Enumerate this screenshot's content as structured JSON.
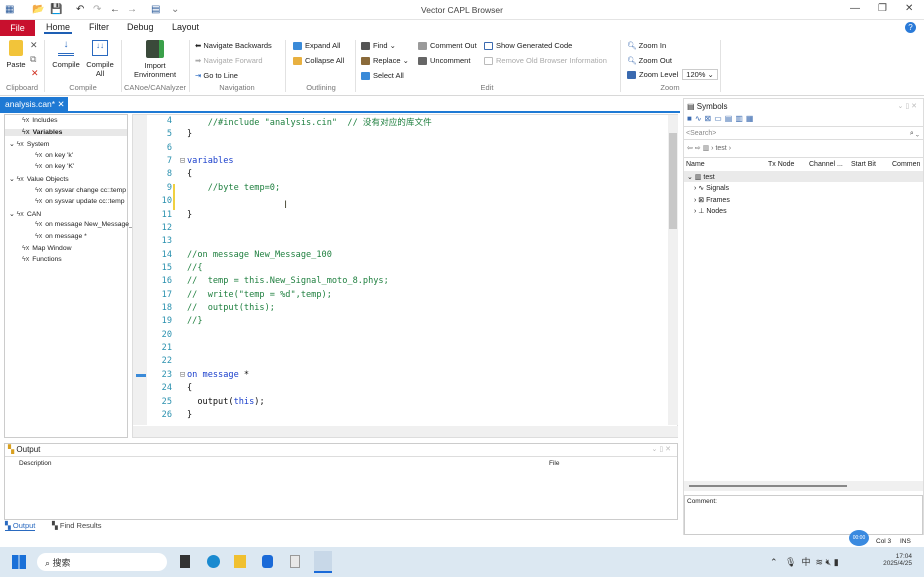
{
  "window": {
    "title": "Vector CAPL Browser"
  },
  "menu": {
    "file": "File",
    "tabs": [
      "Home",
      "Filter",
      "Debug",
      "Layout"
    ]
  },
  "ribbon": {
    "clipboard": {
      "paste": "Paste",
      "group": "Clipboard"
    },
    "compile": {
      "compile": "Compile",
      "compile_all_1": "Compile",
      "compile_all_2": "All",
      "group": "Compile"
    },
    "canoe": {
      "import_1": "Import",
      "import_2": "Environment",
      "group": "CANoe/CANalyzer"
    },
    "navigation": {
      "back": "Navigate Backwards",
      "forward": "Navigate Forward",
      "goto": "Go to Line",
      "group": "Navigation"
    },
    "outlining": {
      "expand": "Expand All",
      "collapse": "Collapse All",
      "group": "Outlining"
    },
    "edit": {
      "find": "Find",
      "replace": "Replace",
      "select_all": "Select All",
      "comment_out": "Comment Out",
      "uncomment": "Uncomment",
      "show_generated": "Show Generated Code",
      "remove_old": "Remove Old Browser Information",
      "group": "Edit"
    },
    "zoom": {
      "zoom_in": "Zoom In",
      "zoom_out": "Zoom Out",
      "zoom_level": "Zoom Level",
      "zoom_value": "120%",
      "group": "Zoom"
    }
  },
  "doc_tab": {
    "label": "analysis.can*"
  },
  "tree": [
    {
      "label": "Includes",
      "bold": false,
      "indent": 1
    },
    {
      "label": "Variables",
      "bold": true,
      "indent": 1
    },
    {
      "label": "System",
      "indent": 0,
      "expander": true
    },
    {
      "label": "on key 'k'",
      "indent": 2
    },
    {
      "label": "on key 'K'",
      "indent": 2
    },
    {
      "label": "Value Objects",
      "indent": 0,
      "expander": true
    },
    {
      "label": "on sysvar change cc::temp",
      "indent": 2
    },
    {
      "label": "on sysvar update cc::temp",
      "indent": 2
    },
    {
      "label": "CAN",
      "indent": 0,
      "expander": true
    },
    {
      "label": "on message New_Message_",
      "indent": 2
    },
    {
      "label": "on message *",
      "indent": 2
    },
    {
      "label": "Map Window",
      "indent": 1
    },
    {
      "label": "Functions",
      "indent": 1
    }
  ],
  "code": [
    {
      "n": "4",
      "s": [
        {
          "t": "    "
        },
        {
          "t": "//#include \"analysis.cin\"  // 没有对应的库文件",
          "c": "cm"
        }
      ]
    },
    {
      "n": "5",
      "s": [
        {
          "t": "}"
        }
      ]
    },
    {
      "n": "6",
      "s": []
    },
    {
      "n": "7",
      "s": [
        {
          "t": "variables",
          "c": "kw"
        }
      ]
    },
    {
      "n": "8",
      "s": [
        {
          "t": "{"
        }
      ]
    },
    {
      "n": "9",
      "s": [
        {
          "t": "    "
        },
        {
          "t": "//byte temp=0;",
          "c": "cm"
        }
      ]
    },
    {
      "n": "10",
      "s": []
    },
    {
      "n": "11",
      "s": [
        {
          "t": "}"
        }
      ]
    },
    {
      "n": "12",
      "s": []
    },
    {
      "n": "13",
      "s": []
    },
    {
      "n": "14",
      "s": [
        {
          "t": "//on message New_Message_100",
          "c": "cm"
        }
      ]
    },
    {
      "n": "15",
      "s": [
        {
          "t": "//{",
          "c": "cm"
        }
      ]
    },
    {
      "n": "16",
      "s": [
        {
          "t": "//  temp = this.New_Signal_moto_8.phys;",
          "c": "cm"
        }
      ]
    },
    {
      "n": "17",
      "s": [
        {
          "t": "//  write(\"temp = %d\",temp);",
          "c": "cm"
        }
      ]
    },
    {
      "n": "18",
      "s": [
        {
          "t": "//  output(this);",
          "c": "cm"
        }
      ]
    },
    {
      "n": "19",
      "s": [
        {
          "t": "//}",
          "c": "cm"
        }
      ]
    },
    {
      "n": "20",
      "s": []
    },
    {
      "n": "21",
      "s": []
    },
    {
      "n": "22",
      "s": []
    },
    {
      "n": "23",
      "s": [
        {
          "t": "on message",
          "c": "kw"
        },
        {
          "t": " *"
        }
      ]
    },
    {
      "n": "24",
      "s": [
        {
          "t": "{"
        }
      ]
    },
    {
      "n": "25",
      "s": [
        {
          "t": "  output("
        },
        {
          "t": "this",
          "c": "kw"
        },
        {
          "t": ");"
        }
      ]
    },
    {
      "n": "26",
      "s": [
        {
          "t": "}"
        }
      ]
    }
  ],
  "symbols": {
    "title": "Symbols",
    "search_placeholder": "<Search>",
    "breadcrumb": "test",
    "columns": [
      "Name",
      "Tx Node",
      "Channel ...",
      "Start Bit",
      "Commen"
    ],
    "root": "test",
    "children": [
      "Signals",
      "Frames",
      "Nodes"
    ],
    "comment_label": "Comment:"
  },
  "output": {
    "title": "Output",
    "columns": [
      "Description",
      "File"
    ],
    "tabs": [
      "Output",
      "Find Results"
    ]
  },
  "status": {
    "col": "Col 3",
    "mode": "INS",
    "badge": "00:00"
  },
  "taskbar": {
    "search": "搜索",
    "time": "17:04",
    "date": "2025/4/25",
    "ime": "中"
  }
}
